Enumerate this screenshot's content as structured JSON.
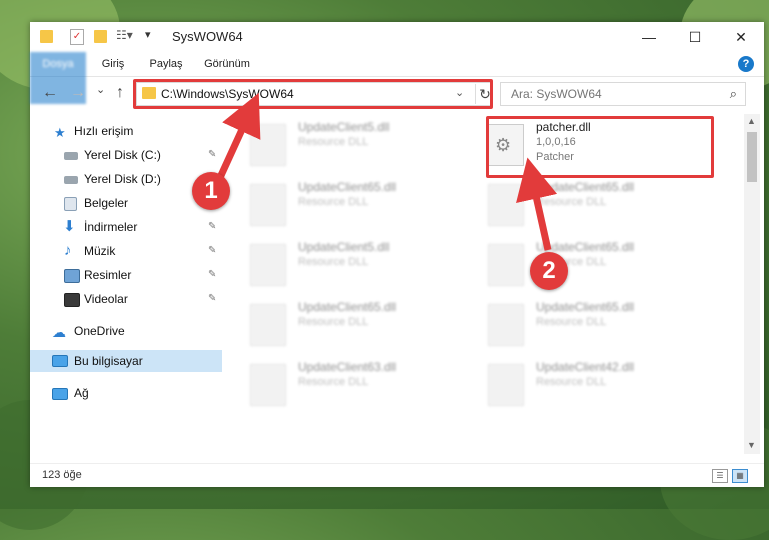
{
  "window": {
    "title": "SysWOW64",
    "controls": {
      "minimize": "—",
      "maximize": "☐",
      "close": "✕"
    }
  },
  "ribbon": {
    "tabs": [
      "Dosya",
      "Giriş",
      "Paylaş",
      "Görünüm"
    ],
    "help": "?"
  },
  "nav": {
    "back": "←",
    "forward": "→",
    "recent": "⌄",
    "up": "↑",
    "address": "C:\\Windows\\SysWOW64",
    "refresh": "↻",
    "dropdown": "⌄",
    "search_placeholder": "Ara: SysWOW64",
    "search_icon": "🔍"
  },
  "sidebar": {
    "items": [
      {
        "label": "Hızlı erişim",
        "icon": "star-icon",
        "pinned": false
      },
      {
        "label": "Yerel Disk (C:)",
        "icon": "drive-icon",
        "pinned": true
      },
      {
        "label": "Yerel Disk (D:)",
        "icon": "drive-icon",
        "pinned": true
      },
      {
        "label": "Belgeler",
        "icon": "documents-icon",
        "pinned": true
      },
      {
        "label": "İndirmeler",
        "icon": "download-icon",
        "pinned": true
      },
      {
        "label": "Müzik",
        "icon": "music-icon",
        "pinned": true
      },
      {
        "label": "Resimler",
        "icon": "pictures-icon",
        "pinned": true
      },
      {
        "label": "Videolar",
        "icon": "video-icon",
        "pinned": true
      },
      {
        "label": "OneDrive",
        "icon": "cloud-icon",
        "pinned": false
      },
      {
        "label": "Bu bilgisayar",
        "icon": "computer-icon",
        "pinned": false,
        "selected": true
      },
      {
        "label": "Ağ",
        "icon": "network-icon",
        "pinned": false
      }
    ],
    "pin_glyph": "📌"
  },
  "files": {
    "left": [
      {
        "name": "UpdateClient5.dll",
        "type": "Resource DLL"
      },
      {
        "name": "UpdateClient65.dll",
        "type": "Resource DLL"
      },
      {
        "name": "UpdateClient5.dll",
        "type": "Resource DLL"
      },
      {
        "name": "UpdateClient65.dll",
        "type": "Resource DLL"
      },
      {
        "name": "UpdateClient63.dll",
        "type": "Resource DLL"
      }
    ],
    "right": [
      {
        "name": "patcher.dll",
        "version": "1,0,0,16",
        "desc": "Patcher"
      },
      {
        "name": "UpdateClient65.dll",
        "type": "Resource DLL"
      },
      {
        "name": "UpdateClient65.dll",
        "type": "Resource DLL"
      },
      {
        "name": "UpdateClient65.dll",
        "type": "Resource DLL"
      },
      {
        "name": "UpdateClient42.dll",
        "type": "Resource DLL"
      }
    ]
  },
  "status": {
    "count": "123 öğe"
  },
  "annotations": {
    "step1": "1",
    "step2": "2"
  },
  "colors": {
    "accent": "#1979ca",
    "highlight": "#e23b3b",
    "selected": "#cce4f7",
    "folder": "#f6c647"
  }
}
